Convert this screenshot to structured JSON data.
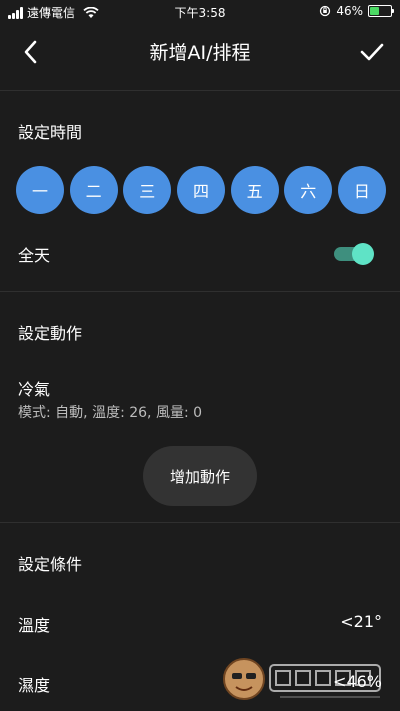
{
  "status": {
    "carrier": "遠傳電信",
    "time": "下午3:58",
    "battery_percent": "46%",
    "battery_level": 0.46
  },
  "nav": {
    "title": "新增AI/排程",
    "back_icon": "chevron-left-icon",
    "confirm_icon": "check-icon"
  },
  "time_section": {
    "title": "設定時間",
    "days": [
      "一",
      "二",
      "三",
      "四",
      "五",
      "六",
      "日"
    ],
    "all_day_label": "全天",
    "all_day_on": true
  },
  "action_section": {
    "title": "設定動作",
    "action_name": "冷氣",
    "action_desc": "模式: 自動, 溫度: 26, 風量: 0",
    "add_button": "增加動作"
  },
  "condition_section": {
    "title": "設定條件",
    "conditions": [
      {
        "label": "溫度",
        "value": "<21°"
      },
      {
        "label": "濕度",
        "value": "<46%"
      }
    ]
  },
  "colors": {
    "background": "#1c1c1c",
    "day_blue": "#4a90e2",
    "toggle_on": "#5fe3c6",
    "button_bg": "#333333"
  }
}
